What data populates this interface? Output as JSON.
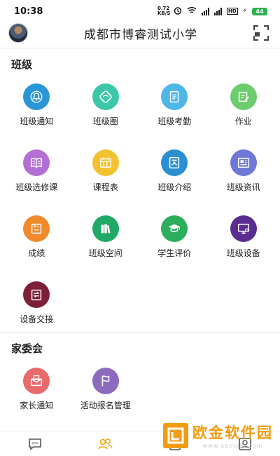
{
  "status_bar": {
    "time": "10:38",
    "network_speed": "0.72 KB/S",
    "battery": "44"
  },
  "header": {
    "title": "成都市博睿测试小学"
  },
  "class_section": {
    "title": "班级",
    "items": [
      {
        "label": "班级通知",
        "icon": "bell-icon",
        "color": "#2b96d6"
      },
      {
        "label": "班级圈",
        "icon": "circle-ring-icon",
        "color": "#3cc7a8"
      },
      {
        "label": "班级考勤",
        "icon": "attendance-doc-icon",
        "color": "#4fb6e8"
      },
      {
        "label": "作业",
        "icon": "homework-edit-icon",
        "color": "#6dcc6d"
      },
      {
        "label": "班级选修课",
        "icon": "open-book-icon",
        "color": "#b36fd6"
      },
      {
        "label": "课程表",
        "icon": "timetable-icon",
        "color": "#f2c230"
      },
      {
        "label": "班级介绍",
        "icon": "class-intro-icon",
        "color": "#2a8fd0"
      },
      {
        "label": "班级资讯",
        "icon": "news-icon",
        "color": "#6f78d6"
      },
      {
        "label": "成绩",
        "icon": "score-sheet-icon",
        "color": "#f08a2c"
      },
      {
        "label": "班级空间",
        "icon": "books-icon",
        "color": "#1fa866"
      },
      {
        "label": "学生评价",
        "icon": "graduate-icon",
        "color": "#2cae5c"
      },
      {
        "label": "班级设备",
        "icon": "device-monitor-icon",
        "color": "#5a2d91"
      },
      {
        "label": "设备交接",
        "icon": "device-handover-icon",
        "color": "#7e1f3a"
      }
    ]
  },
  "parent_section": {
    "title": "家委会",
    "items": [
      {
        "label": "家长通知",
        "icon": "mail-icon",
        "color": "#e86a6a"
      },
      {
        "label": "活动报名管理",
        "icon": "flag-icon",
        "color": "#8c6bbf"
      }
    ]
  },
  "tabbar": {
    "tabs": [
      {
        "icon": "chat-icon",
        "active": false
      },
      {
        "icon": "contacts-icon",
        "active": true
      },
      {
        "icon": "apps-icon",
        "active": false
      },
      {
        "icon": "profile-icon",
        "active": false
      }
    ],
    "active_color": "#f2a100"
  },
  "watermark": {
    "title": "欧金软件园",
    "url": "www.apoujin.com"
  }
}
